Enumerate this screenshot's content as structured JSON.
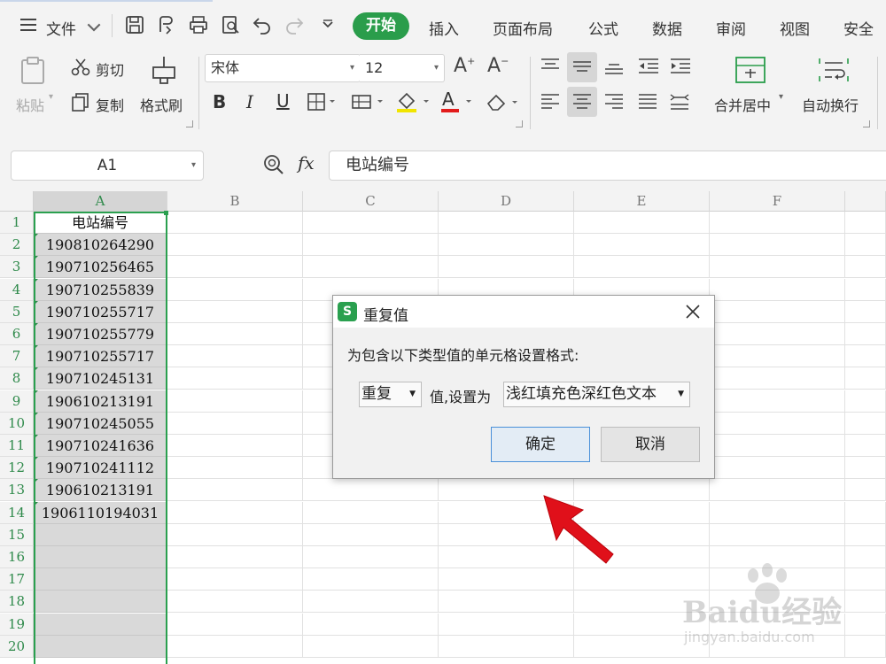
{
  "menubar": {
    "file_label": "文件",
    "tabs": [
      "开始",
      "插入",
      "页面布局",
      "公式",
      "数据",
      "审阅",
      "视图",
      "安全"
    ],
    "active_tab": "开始"
  },
  "toolbar": {
    "paste_label": "粘贴",
    "cut_label": "剪切",
    "copy_label": "复制",
    "format_painter_label": "格式刷",
    "font_name": "宋体",
    "font_size": "12",
    "merge_center_label": "合并居中",
    "wrap_text_label": "自动换行",
    "bold_label": "B",
    "italic_label": "I",
    "underline_label": "U",
    "grow_font_label": "A",
    "shrink_font_label": "A",
    "font_color_label": "A"
  },
  "formula_bar": {
    "cell_ref": "A1",
    "fx_label": "fx",
    "content": "电站编号"
  },
  "sheet": {
    "columns": [
      "A",
      "B",
      "C",
      "D",
      "E",
      "F"
    ],
    "rows": [
      "1",
      "2",
      "3",
      "4",
      "5",
      "6",
      "7",
      "8",
      "9",
      "10",
      "11",
      "12",
      "13",
      "14",
      "15",
      "16",
      "17",
      "18",
      "19",
      "20"
    ],
    "column_a": [
      "电站编号",
      "190810264290",
      "190710256465",
      "190710255839",
      "190710255717",
      "190710255779",
      "190710255717",
      "190710245131",
      "190610213191",
      "190710245055",
      "190710241636",
      "190710241112",
      "190610213191",
      "1906110194031",
      "",
      "",
      "",
      "",
      "",
      ""
    ]
  },
  "dialog": {
    "title": "重复值",
    "logo": "S",
    "prompt": "为包含以下类型值的单元格设置格式:",
    "type_value": "重复",
    "mid_label": "值,设置为",
    "format_value": "浅红填充色深红色文本",
    "ok_label": "确定",
    "cancel_label": "取消"
  },
  "watermark": {
    "main": "Baidu经验",
    "sub": "jingyan.baidu.com"
  },
  "colors": {
    "accent_green": "#2a9d4b",
    "selection_green": "#2aa04f",
    "arrow_red": "#e0101a"
  }
}
